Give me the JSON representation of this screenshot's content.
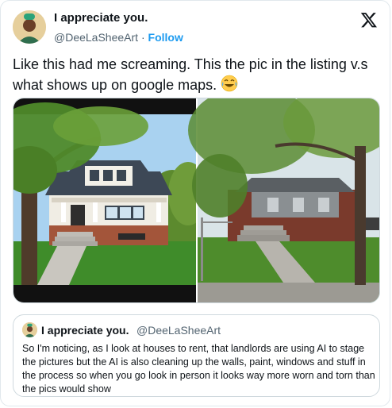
{
  "post": {
    "author_name": "I appreciate you.",
    "handle": "@DeeLaSheeArt",
    "separator": "·",
    "follow_label": "Follow",
    "text": "Like this had me screaming. This the pic in the listing v.s what shows up on google maps.",
    "emoji": "😂"
  },
  "quoted": {
    "author_name": "I appreciate you.",
    "handle": "@DeeLaSheeArt",
    "text": "So I'm noticing, as I look at houses to rent, that landlords are using AI to stage the pictures but the AI is also cleaning up the walls, paint, windows and stuff in the process so when you go look in person it looks way more worn and torn than the pics would show"
  },
  "icons": {
    "brand": "x-logo-icon",
    "avatar": "avatar-illustration"
  },
  "colors": {
    "follow": "#1d9bf0",
    "secondary_text": "#536471",
    "border": "#cfd9de"
  }
}
